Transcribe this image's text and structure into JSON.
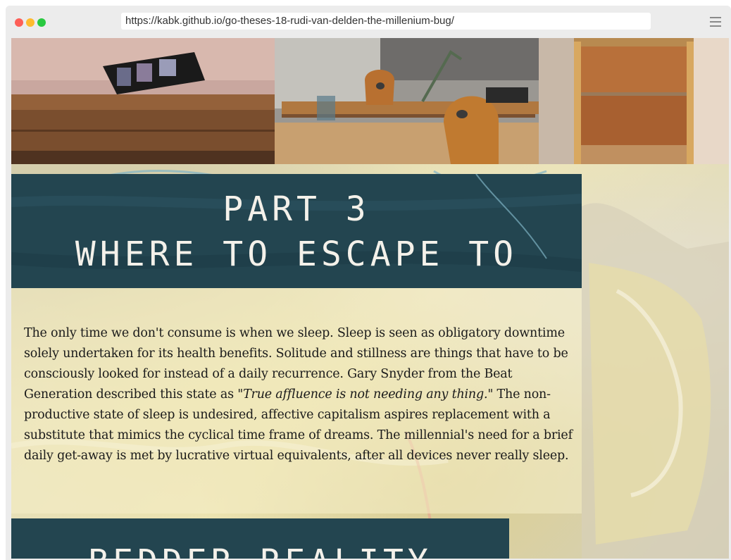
{
  "browser": {
    "url": "https://kabk.github.io/go-theses-18-rudi-van-delden-the-millenium-bug/"
  },
  "heading": {
    "line1": "PART 3",
    "line2": "WHERE TO ESCAPE TO"
  },
  "body": {
    "paragraph_part1": "The only time we don't consume is when we sleep. Sleep is seen as obligatory downtime solely undertaken for its health benefits. Solitude and stillness are things that have to be consciously looked for instead of a daily recurrence. Gary Snyder from the Beat Generation described this state as \"",
    "quote": "True affluence is not needing any thing.",
    "paragraph_part2": "\" The non-productive state of sleep is undesired, affective capitalism aspires replacement with a substitute that mimics the cyclical time frame of dreams. The millennial's need for a brief daily get-away is met by lucrative virtual equivalents, after all devices never really sleep."
  },
  "next_heading": {
    "line1": "BEDDER REALITY"
  },
  "colors": {
    "banner": "#234550",
    "banner_text": "#f4f1ea",
    "punctuation_accent": "#d42020"
  }
}
